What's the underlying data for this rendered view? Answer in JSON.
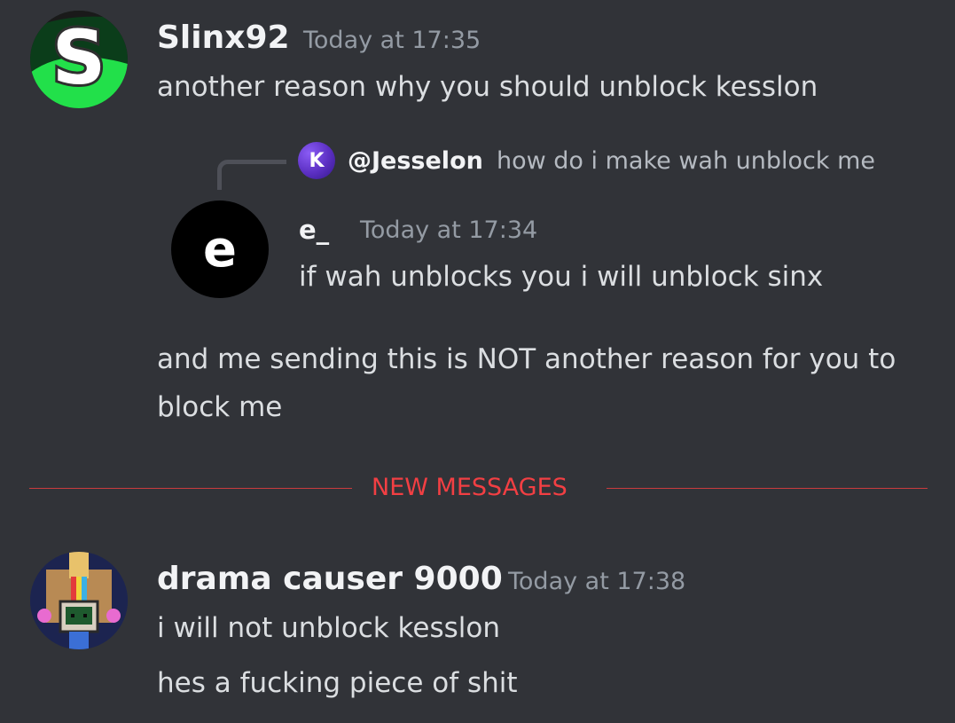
{
  "messages": [
    {
      "username": "Slinx92",
      "timestamp": "Today at 17:35",
      "avatar_icon": "slinx-s-logo",
      "lines": [
        "another reason why you should unblock kesslon"
      ]
    },
    {
      "reply": {
        "author": "@Jesselon",
        "avatar_letter": "K",
        "preview": "how do i make wah unblock me"
      },
      "quoted": {
        "username": "e_",
        "avatar_letter": "e",
        "timestamp": "Today at 17:34",
        "text": "if wah unblocks you i will unblock sinx"
      },
      "followup": "and me sending this is NOT another reason for you to block me"
    },
    {
      "username": "drama causer 9000",
      "timestamp": "Today at 17:38",
      "avatar_icon": "pixel-robot-avatar",
      "lines": [
        "i will not unblock kesslon",
        "hes a fucking piece of shit"
      ]
    }
  ],
  "divider": {
    "label": "NEW MESSAGES"
  },
  "colors": {
    "background": "#313338",
    "divider": "#f23f43",
    "username": "#f2f3f5",
    "timestamp": "#949ba4",
    "text": "#dbdee1"
  }
}
